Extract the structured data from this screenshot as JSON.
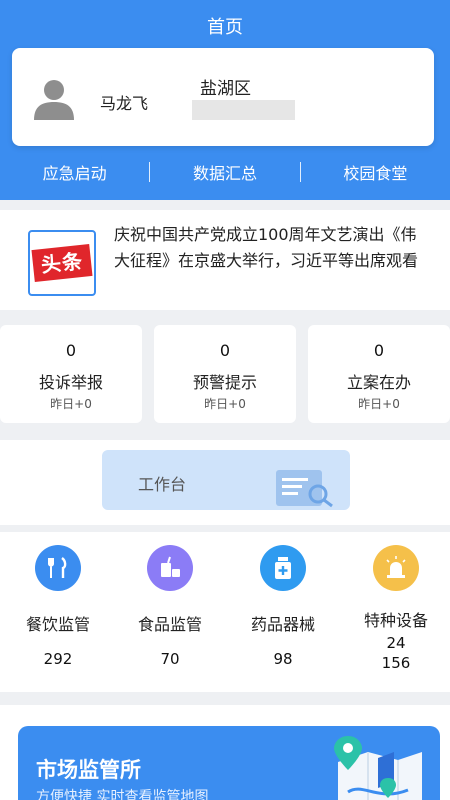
{
  "header": {
    "title": "首页"
  },
  "profile": {
    "name": "马龙飞",
    "district": "盐湖区",
    "district_sub": ""
  },
  "quick_nav": [
    {
      "label": "应急启动"
    },
    {
      "label": "数据汇总"
    },
    {
      "label": "校园食堂"
    }
  ],
  "news": {
    "badge": "头条",
    "text": "庆祝中国共产党成立100周年文艺演出《伟大征程》在京盛大举行，习近平等出席观看"
  },
  "stats": [
    {
      "value": "0",
      "label": "投诉举报",
      "sub": "昨日+0"
    },
    {
      "value": "0",
      "label": "预警提示",
      "sub": "昨日+0"
    },
    {
      "value": "0",
      "label": "立案在办",
      "sub": "昨日+0"
    }
  ],
  "workbench": {
    "label": "工作台"
  },
  "modules": [
    {
      "label": "餐饮监管",
      "count": "292",
      "icon": "fork-knife-icon",
      "color": "#3b8df0"
    },
    {
      "label": "食品监管",
      "count": "70",
      "icon": "food-icon",
      "color": "#8b7cf6"
    },
    {
      "label": "药品器械",
      "count": "98",
      "icon": "medicine-bottle-icon",
      "color": "#2f9bf0"
    },
    {
      "label": "特种设备",
      "count": "24",
      "count2": "156",
      "icon": "alarm-light-icon",
      "color": "#f5c04a"
    }
  ],
  "banner": {
    "title": "市场监管所",
    "subtitle": "方便快捷 实时查看监管地图"
  },
  "colors": {
    "primary": "#3b8df0",
    "news_badge_red": "#e0262b"
  }
}
